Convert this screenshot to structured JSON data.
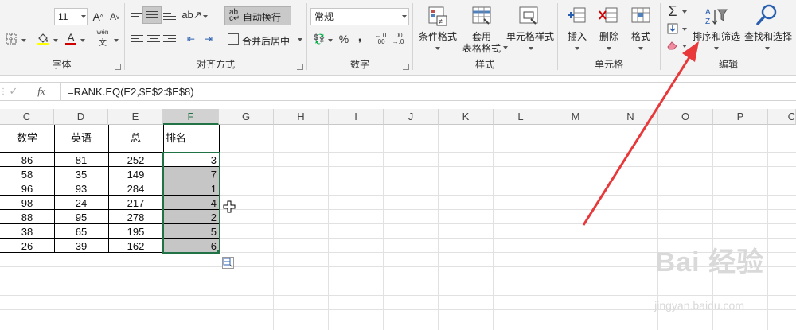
{
  "ribbon": {
    "font_group": {
      "label": "字体",
      "font_size": "11",
      "grow_icon": "A",
      "shrink_icon": "A",
      "border_icon": "border-icon",
      "fill_icon": "fill-color-icon",
      "font_color_icon": "A",
      "phonetic_icon": "wén",
      "fill_color": "#ffff00",
      "font_color": "#d00000"
    },
    "align_group": {
      "label": "对齐方式",
      "wrap_text": "自动换行",
      "merge_center": "合并后居中"
    },
    "number_group": {
      "label": "数字",
      "format": "常规",
      "percent": "%",
      "comma": ",",
      "increase_decimal": "←.0\n.00",
      "decrease_decimal": ".00\n→.0"
    },
    "styles_group": {
      "label": "样式",
      "conditional_format": "条件格式",
      "format_as_table_1": "套用",
      "format_as_table_2": "表格格式",
      "cell_styles": "单元格样式"
    },
    "cells_group": {
      "label": "单元格",
      "insert": "插入",
      "delete": "删除",
      "format": "格式"
    },
    "editing_group": {
      "label": "编辑",
      "sort_filter": "排序和筛选",
      "find_select": "查找和选择"
    }
  },
  "formula_bar": {
    "cancel": "✓",
    "fx": "fx",
    "formula": "=RANK.EQ(E2,$E$2:$E$8)"
  },
  "columns": [
    "C",
    "D",
    "E",
    "F",
    "G",
    "H",
    "I",
    "J",
    "K",
    "L",
    "M",
    "N",
    "O",
    "P",
    "C"
  ],
  "table": {
    "headers": [
      "数学",
      "英语",
      "总",
      "排名"
    ],
    "rows": [
      [
        "86",
        "81",
        "252",
        "3"
      ],
      [
        "58",
        "35",
        "149",
        "7"
      ],
      [
        "96",
        "93",
        "284",
        "1"
      ],
      [
        "98",
        "24",
        "217",
        "4"
      ],
      [
        "88",
        "95",
        "278",
        "2"
      ],
      [
        "38",
        "65",
        "195",
        "5"
      ],
      [
        "26",
        "39",
        "162",
        "6"
      ]
    ]
  },
  "watermark": {
    "text": "Bai 经验",
    "sub": "jingyan.baidu.com"
  },
  "colors": {
    "accent_green": "#217346",
    "arrow_red": "#e8383a"
  }
}
